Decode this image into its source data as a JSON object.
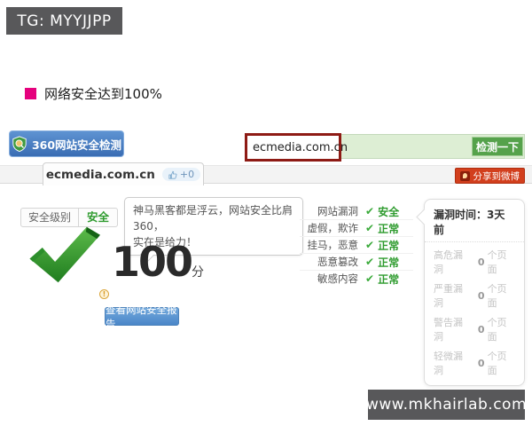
{
  "watermark_top": {
    "text": "TG: MYYJJPP"
  },
  "watermark_bottom": {
    "text": "www.mkhairlab.com"
  },
  "heading": {
    "text": "网络安全达到100%"
  },
  "scanner": {
    "brand": "360网站安全检测",
    "url": "ecmedia.com.cn",
    "check_button": "检测一下"
  },
  "tabbar": {
    "tab_label": "ecmedia.com.cn",
    "likes": "+0",
    "share_label": "分享到微博"
  },
  "result": {
    "level_label": "安全级别",
    "level_value": "安全",
    "bubble_line1": "神马黑客都是浮云，网站安全比肩360，",
    "bubble_line2": "实在是给力！",
    "score": "100",
    "score_unit": "分",
    "info_mark": "!",
    "report_button": "查看网站安全报告"
  },
  "checks": [
    {
      "label": "网站漏洞",
      "status": "安全"
    },
    {
      "label": "虚假，欺诈",
      "status": "正常"
    },
    {
      "label": "挂马，恶意",
      "status": "正常"
    },
    {
      "label": "恶意篡改",
      "status": "正常"
    },
    {
      "label": "敏感内容",
      "status": "正常"
    }
  ],
  "vuln_panel": {
    "title": "漏洞时间：3天前",
    "rows": [
      {
        "label": "高危漏洞",
        "count": "0",
        "unit": "个页面"
      },
      {
        "label": "严重漏洞",
        "count": "0",
        "unit": "个页面"
      },
      {
        "label": "警告漏洞",
        "count": "0",
        "unit": "个页面"
      },
      {
        "label": "轻微漏洞",
        "count": "0",
        "unit": "个页面"
      }
    ]
  },
  "colors": {
    "watermark_bg": "#58585a",
    "heading_bullet": "#e5017d",
    "banner_blue": "#3a6db3",
    "search_green_bg": "#ddeed4",
    "url_highlight_border": "#8e1b15",
    "check_button_green": "#55a24b",
    "share_red": "#d23f1d",
    "status_green": "#2e9b2e",
    "report_button_blue": "#4a86c8"
  }
}
